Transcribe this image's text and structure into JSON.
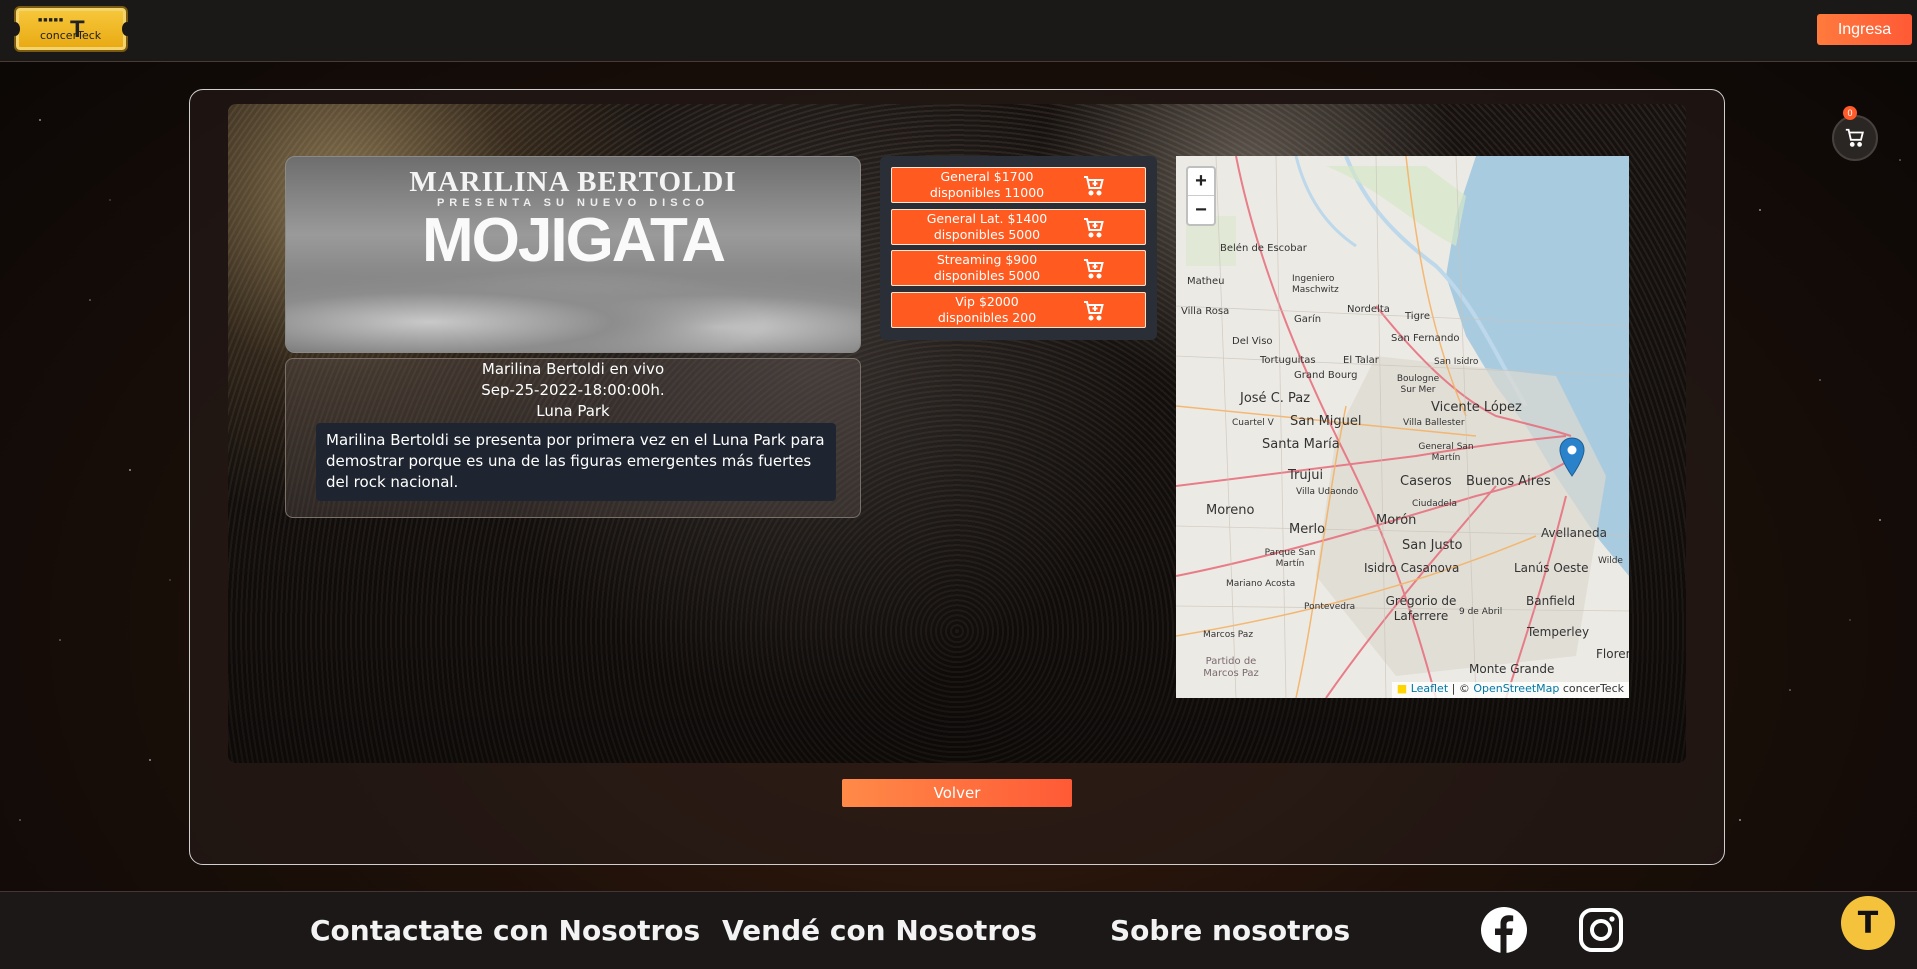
{
  "header": {
    "logo_text": "concerTeck",
    "login_label": "Ingresa"
  },
  "cart": {
    "count": "0"
  },
  "event": {
    "poster": {
      "artist": "MARILINA BERTOLDI",
      "subtitle": "PRESENTA SU NUEVO DISCO",
      "album": "MOJIGATA"
    },
    "title": "Marilina Bertoldi en vivo",
    "datetime": "Sep-25-2022-18:00:00h.",
    "venue": "Luna Park",
    "description": "Marilina Bertoldi se presenta por primera vez en el Luna Park para demostrar porque es una de las figuras emergentes más fuertes del rock nacional."
  },
  "tickets": [
    {
      "line1": "General $1700",
      "line2": "disponibles 11000"
    },
    {
      "line1": "General Lat. $1400",
      "line2": "disponibles 5000"
    },
    {
      "line1": "Streaming $900",
      "line2": "disponibles 5000"
    },
    {
      "line1": "Vip $2000",
      "line2": "disponibles 200"
    }
  ],
  "map": {
    "zoom_in": "+",
    "zoom_out": "−",
    "attribution": {
      "leaflet": "Leaflet",
      "sep": " | © ",
      "osm": "OpenStreetMap",
      "suffix": " concerTeck"
    },
    "places": [
      "Belén de Escobar",
      "Matheu",
      "Ingeniero Maschwitz",
      "Villa Rosa",
      "Garín",
      "Nordelta",
      "Tigre",
      "Del Viso",
      "San Fernando",
      "Tortuguitas",
      "El Talar",
      "San Isidro",
      "Grand Bourg",
      "Boulogne Sur Mer",
      "José C. Paz",
      "Vicente López",
      "Cuartel V",
      "San Miguel",
      "Villa Ballester",
      "Santa María",
      "General San Martín",
      "Trujui",
      "Caseros",
      "Buenos Aires",
      "Villa Udaondo",
      "Ciudadela",
      "Moreno",
      "Morón",
      "Merlo",
      "Avellaneda",
      "San Justo",
      "Parque San Martín",
      "Wilde",
      "Isidro Casanova",
      "Lanús Oeste",
      "Mariano Acosta",
      "Pontevedra",
      "Gregorio de Laferrere",
      "Banfield",
      "9 de Abril",
      "Marcos Paz",
      "Temperley",
      "Partido de Marcos Paz",
      "Monte Grande",
      "Florenc"
    ]
  },
  "back_label": "Volver",
  "footer": {
    "contact": "Contactate con Nosotros",
    "sell": "Vendé con Nosotros",
    "about": "Sobre nosotros",
    "help_glyph": "T"
  },
  "colors": {
    "accent": "#ff5a1f",
    "gold": "#f5c33b",
    "footer_bg": "#1c1818"
  },
  "icons": [
    "cart-icon",
    "add-to-cart-icon",
    "facebook-icon",
    "instagram-icon",
    "map-pin-icon"
  ]
}
